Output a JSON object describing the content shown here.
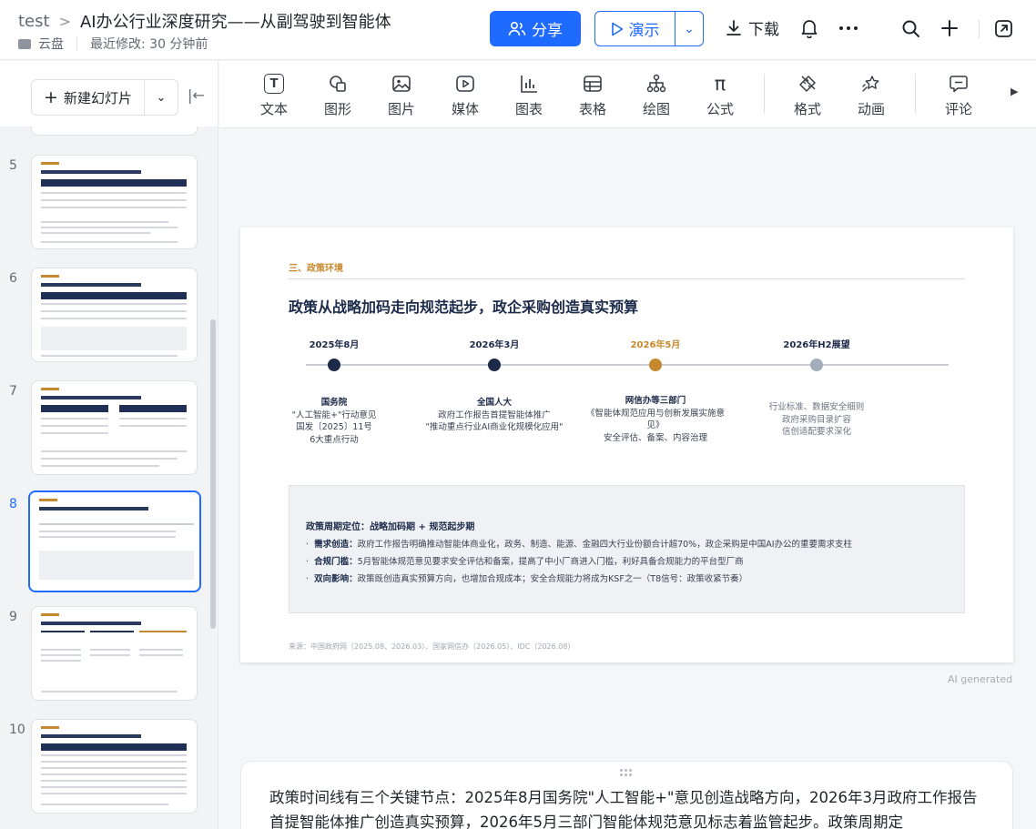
{
  "header": {
    "workspace": "test",
    "doc_title": "AI办公行业深度研究——从副驾驶到智能体",
    "location": "云盘",
    "last_modified": "最近修改: 30 分钟前",
    "share_label": "分享",
    "present_label": "演示",
    "download_label": "下载"
  },
  "icons": {
    "share": "users-icon",
    "present": "play-icon",
    "download": "download-icon",
    "bell": "bell-icon",
    "more": "more-icon",
    "search": "search-icon",
    "add": "plus-icon",
    "external": "open-external-icon"
  },
  "sidebar": {
    "new_slide_label": "新建幻灯片",
    "slides": [
      {
        "number": "5",
        "active": false
      },
      {
        "number": "6",
        "active": false
      },
      {
        "number": "7",
        "active": false
      },
      {
        "number": "8",
        "active": true
      },
      {
        "number": "9",
        "active": false
      },
      {
        "number": "10",
        "active": false
      }
    ]
  },
  "toolbar": {
    "items": [
      {
        "label": "文本",
        "icon": "text-icon"
      },
      {
        "label": "图形",
        "icon": "shape-icon"
      },
      {
        "label": "图片",
        "icon": "image-icon"
      },
      {
        "label": "媒体",
        "icon": "media-icon"
      },
      {
        "label": "图表",
        "icon": "chart-icon"
      },
      {
        "label": "表格",
        "icon": "table-icon"
      },
      {
        "label": "绘图",
        "icon": "diagram-icon"
      },
      {
        "label": "公式",
        "icon": "formula-icon"
      },
      {
        "label": "格式",
        "icon": "format-icon"
      },
      {
        "label": "动画",
        "icon": "animation-icon"
      },
      {
        "label": "评论",
        "icon": "comment-icon"
      }
    ]
  },
  "slide": {
    "section": "三、政策环境",
    "title": "政策从战略加码走向规范起步，政企采购创造真实预算",
    "timeline": [
      {
        "date": "2025年8月",
        "color": "#1c2b4a",
        "heading": "国务院",
        "lines": [
          "\"人工智能+\"行动意见",
          "国发〔2025〕11号",
          "6大重点行动"
        ]
      },
      {
        "date": "2026年3月",
        "color": "#1c2b4a",
        "heading": "全国人大",
        "lines": [
          "政府工作报告首提智能体推广",
          "\"推动重点行业AI商业化规模化应用\""
        ]
      },
      {
        "date": "2026年5月",
        "color": "#c8892e",
        "heading": "网信办等三部门",
        "lines": [
          "《智能体规范应用与创新发展实施意",
          "见》",
          "安全评估、备案、内容治理"
        ]
      },
      {
        "date": "2026年H2展望",
        "color": "#a3acbb",
        "heading": "",
        "lines": [
          "行业标准、数据安全细则",
          "政府采购目录扩容",
          "信创适配要求深化"
        ]
      }
    ],
    "box_title": "政策周期定位：战略加码期 + 规范起步期",
    "bullets": [
      {
        "label": "需求创造：",
        "text": "政府工作报告明确推动智能体商业化，政务、制造、能源、金融四大行业份额合计超70%，政企采购是中国AI办公的重要需求支柱"
      },
      {
        "label": "合规门槛：",
        "text": "5月智能体规范意见要求安全评估和备案，提高了中小厂商进入门槛，利好具备合规能力的平台型厂商"
      },
      {
        "label": "双向影响：",
        "text": "政策既创造真实预算方向，也增加合规成本；安全合规能力将成为KSF之一（T8信号：政策收紧节奏）"
      }
    ],
    "source": "来源：中国政府网（2025.08、2026.03）、国家网信办（2026.05）、IDC（2026.08）"
  },
  "ai_generated": "AI generated",
  "notes": {
    "text": "政策时间线有三个关键节点：2025年8月国务院\"人工智能+\"意见创造战略方向，2026年3月政府工作报告首提智能体推广创造真实预算，2026年5月三部门智能体规范意见标志着监管起步。政策周期定"
  }
}
